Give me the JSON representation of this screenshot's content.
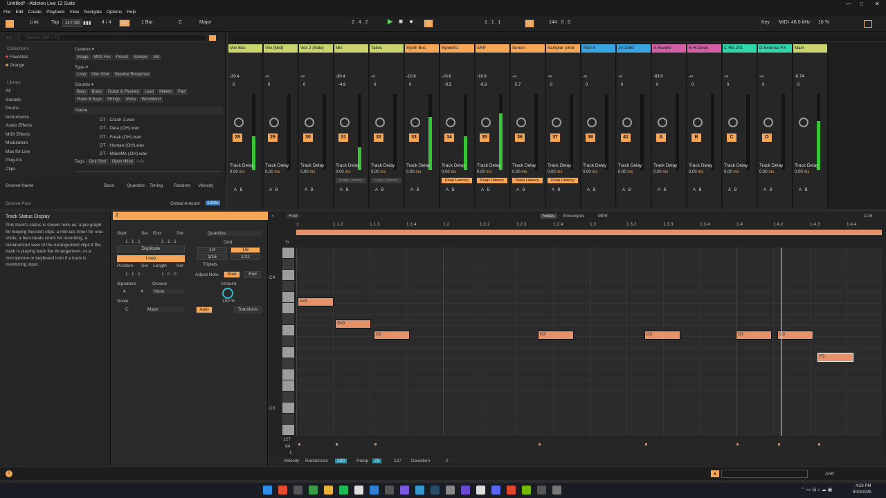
{
  "window": {
    "title": "Untitled* - Ableton Live 12 Suite"
  },
  "menu": [
    "File",
    "Edit",
    "Create",
    "Playback",
    "View",
    "Navigate",
    "Options",
    "Help"
  ],
  "transport": {
    "link": "Link",
    "tap": "Tap",
    "tempo": "117.00",
    "meter_glyph": "▮▮▮",
    "signature": "4 / 4",
    "quantize": "1 Bar",
    "key_note": "C",
    "key_scale": "Major",
    "arrangement_pos": "2 .  4 .  2",
    "loop_start": "1 .  1 .  1",
    "loop_length": "144 .  0 .  0",
    "key_label": "Key",
    "midi_label": "MIDI",
    "sample_rate": "48.0 kHz",
    "cpu": "16 %"
  },
  "browser": {
    "search_placeholder": "Search (Ctrl + F)",
    "collections_label": "Collections",
    "collections": [
      "Favorites",
      "Orange"
    ],
    "library_label": "Library",
    "library": [
      "All",
      "Sounds",
      "Drums",
      "Instruments",
      "Audio Effects",
      "MIDI Effects",
      "Modulators",
      "Max for Live",
      "Plug-Ins",
      "Clips"
    ],
    "content_label": "Content ▾",
    "content_filters": [
      "Image",
      "MIDI File",
      "Preset",
      "Sample",
      "Set"
    ],
    "type_label": "Type ▾",
    "type_filters": [
      "Loop",
      "One Shot",
      "Impulse Response"
    ],
    "sounds_label": "Sounds ▾",
    "sounds_row1": [
      "Bass",
      "Brass",
      "Guitar & Plucked",
      "Lead",
      "Mallets",
      "Pad"
    ],
    "sounds_row2": [
      "Piano & Keys",
      "Strings",
      "Voice",
      "Woodwind"
    ],
    "name_header": "Name",
    "files": [
      "DT - Crash 1.wav",
      "DT - Data (OH).wav",
      "DT - Freak (OH).wav",
      "DT - Human (OH).wav",
      "DT - MakeMe (OH).wav"
    ],
    "tags_label": "Tags:",
    "tags": [
      "One Shot",
      "Open Hihat",
      "Add"
    ]
  },
  "groove": {
    "columns": [
      "Groove Name",
      "Base",
      "Quantize",
      "Timing",
      "Random",
      "Velocity"
    ],
    "pool_label": "Groove Pool",
    "global_amount_label": "Global Amount",
    "global_amount": "100%"
  },
  "tracks": [
    {
      "name": "Vox Bus",
      "color": "#c9d46c",
      "vol": "-30.4",
      "pan": "0",
      "num": "28",
      "meter": 0.45,
      "keep": ""
    },
    {
      "name": "Vox (Mid)",
      "color": "#c9d46c",
      "vol": "-∞",
      "pan": "0",
      "num": "29",
      "meter": 0,
      "keep": ""
    },
    {
      "name": "Vox 2 (Side)",
      "color": "#c9d46c",
      "vol": "-∞",
      "pan": "0",
      "num": "30",
      "meter": 0,
      "keep": ""
    },
    {
      "name": "Mic",
      "color": "#c9d46c",
      "vol": "-30.4",
      "pan": "-4.9",
      "num": "31",
      "meter": 0.3,
      "keep": "Keep Latency"
    },
    {
      "name": "Takes",
      "color": "#c9d46c",
      "vol": "-∞",
      "pan": "0",
      "num": "32",
      "meter": 0,
      "keep": "Keep Latency"
    },
    {
      "name": "Synth Bus",
      "color": "#f5a657",
      "vol": "-10.8",
      "pan": "0",
      "num": "33",
      "meter": 0.7,
      "keep": ""
    },
    {
      "name": "Sylenth1",
      "color": "#f5a657",
      "vol": "-16.6",
      "pan": "-0.5",
      "num": "34",
      "meter": 0.45,
      "keep": "Keep Latency"
    },
    {
      "name": "ARP",
      "color": "#f5a657",
      "vol": "-16.9",
      "pan": "-0.8",
      "num": "35",
      "meter": 0.75,
      "keep": "Keep Latency"
    },
    {
      "name": "Serum",
      "color": "#f5a657",
      "vol": "-∞",
      "pan": "5.7",
      "num": "36",
      "meter": 0,
      "keep": "Keep Latency"
    },
    {
      "name": "Sampler (chor",
      "color": "#f5a657",
      "vol": "-∞",
      "pan": "0",
      "num": "37",
      "meter": 0,
      "keep": "Keep Latency"
    },
    {
      "name": "TEO-5",
      "color": "#39a5e0",
      "vol": "-∞",
      "pan": "0",
      "num": "38",
      "meter": 0,
      "keep": ""
    },
    {
      "name": "JV-1080",
      "color": "#39a5e0",
      "vol": "-∞",
      "pan": "0",
      "num": "41",
      "meter": 0,
      "keep": ""
    },
    {
      "name": "A Reverb",
      "color": "#d35fa6",
      "vol": "-83.0",
      "pan": "0",
      "num": "A",
      "meter": 0,
      "keep": ""
    },
    {
      "name": "B H-Delay",
      "color": "#d35fa6",
      "vol": "-∞",
      "pan": "0",
      "num": "B",
      "meter": 0,
      "keep": ""
    },
    {
      "name": "C RE-201",
      "color": "#2fd6a9",
      "vol": "-∞",
      "pan": "0",
      "num": "C",
      "meter": 0,
      "keep": ""
    },
    {
      "name": "D External FX",
      "color": "#2fd6a9",
      "vol": "-∞",
      "pan": "0",
      "num": "D",
      "meter": 0,
      "keep": ""
    },
    {
      "name": "Main",
      "color": "#c9d46c",
      "vol": "-8.74",
      "pan": "0",
      "num": "",
      "meter": 0.65,
      "keep": ""
    }
  ],
  "track_delay_label": "Track Delay",
  "track_delay_value": "0.00",
  "ms_label": "ms",
  "info": {
    "title": "Track Status Display",
    "body": "This track's status is shown here as: a pie graph for looping Session clips, a min:sec timer for one-shots, a bars:beats count for recording, a miniaturized view of the Arrangement clips if the track is playing back the Arrangement, or a microphone or keyboard icon if a track is monitoring input."
  },
  "clip": {
    "name": "2",
    "start_label": "Start",
    "end_label": "End",
    "set_label": "Set",
    "start": "1 .  1 .  1",
    "end": "2 .  1 .  1",
    "duplicate": "Duplicate",
    "loop": "Loop",
    "position_label": "Position",
    "length_label": "Length",
    "position": "1 .  1 .  1",
    "length": "1 .  0 .  0",
    "signature_label": "Signature",
    "groove_label": "Groove",
    "sig_num": "4",
    "sig_den": "4",
    "groove": "None",
    "scale_label": "Scale",
    "scale_root": "C",
    "scale_name": "Major",
    "quantize": "Quantize",
    "grid_label": "Grid",
    "grid": [
      "1/4",
      "1/8",
      "1/16",
      "1/32"
    ],
    "triplets": "Triplets",
    "adjust_label": "Adjust Note",
    "adjust_start": "Start",
    "adjust_end": "End",
    "amount_label": "Amount",
    "amount": "100 %",
    "auto": "Auto",
    "transform": "Transform"
  },
  "roll": {
    "fold": "Fold",
    "tabs": [
      "Notes",
      "Envelopes",
      "MPE"
    ],
    "grid_value": "1/16",
    "ruler": [
      "1",
      "1.1.2",
      "1.1.3",
      "1.1.4",
      "1.2",
      "1.2.2",
      "1.2.3",
      "1.2.4",
      "1.3",
      "1.3.2",
      "1.3.3",
      "1.3.4",
      "1.4",
      "1.4.2",
      "1.4.3",
      "1.4.4"
    ],
    "pitch_labels": [
      "C4",
      "C3"
    ],
    "notes": [
      {
        "label": "A#3"
      },
      {
        "label": "G#3"
      },
      {
        "label": "G3"
      },
      {
        "label": "G3"
      },
      {
        "label": "G3"
      },
      {
        "label": "G3"
      },
      {
        "label": "G3"
      },
      {
        "label": "F3"
      }
    ],
    "vel_top": "127",
    "vel_mid": "64",
    "vel_bot": "1",
    "velocity_label": "Velocity",
    "randomize_label": "Randomize",
    "randomize": "100",
    "ramp_label": "Ramp",
    "ramp": "72",
    "ramp2": "127",
    "deviation_label": "Deviation",
    "deviation": "0"
  },
  "status": {
    "track": "ARP"
  },
  "clock": {
    "time": "4:33 PM",
    "date": "9/30/2025"
  }
}
